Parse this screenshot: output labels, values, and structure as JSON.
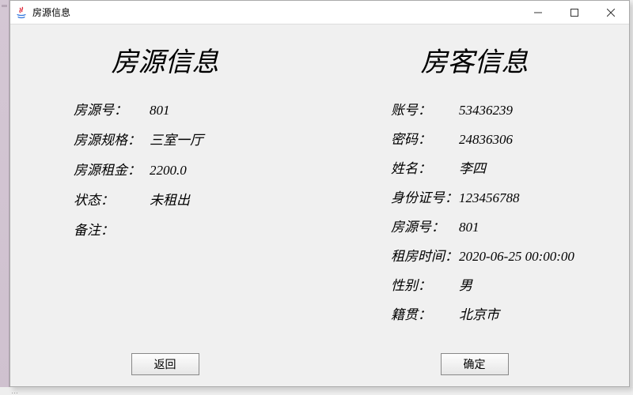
{
  "window": {
    "title": "房源信息"
  },
  "left": {
    "heading": "房源信息",
    "rows": {
      "id_label": "房源号：",
      "id_value": "801",
      "spec_label": "房源规格：",
      "spec_value": "三室一厅",
      "rent_label": "房源租金：",
      "rent_value": "2200.0",
      "status_label": "状态：",
      "status_value": "未租出",
      "remark_label": "备注：",
      "remark_value": ""
    },
    "button": "返回"
  },
  "right": {
    "heading": "房客信息",
    "rows": {
      "account_label": "账号：",
      "account_value": "53436239",
      "password_label": "密码：",
      "password_value": "24836306",
      "name_label": "姓名：",
      "name_value": "李四",
      "idnum_label": "身份证号：",
      "idnum_value": "123456788",
      "house_label": "房源号：",
      "house_value": "801",
      "time_label": "租房时间：",
      "time_value": "2020-06-25 00:00:00",
      "gender_label": "性别：",
      "gender_value": "男",
      "origin_label": "籍贯：",
      "origin_value": "北京市"
    },
    "button": "确定"
  }
}
